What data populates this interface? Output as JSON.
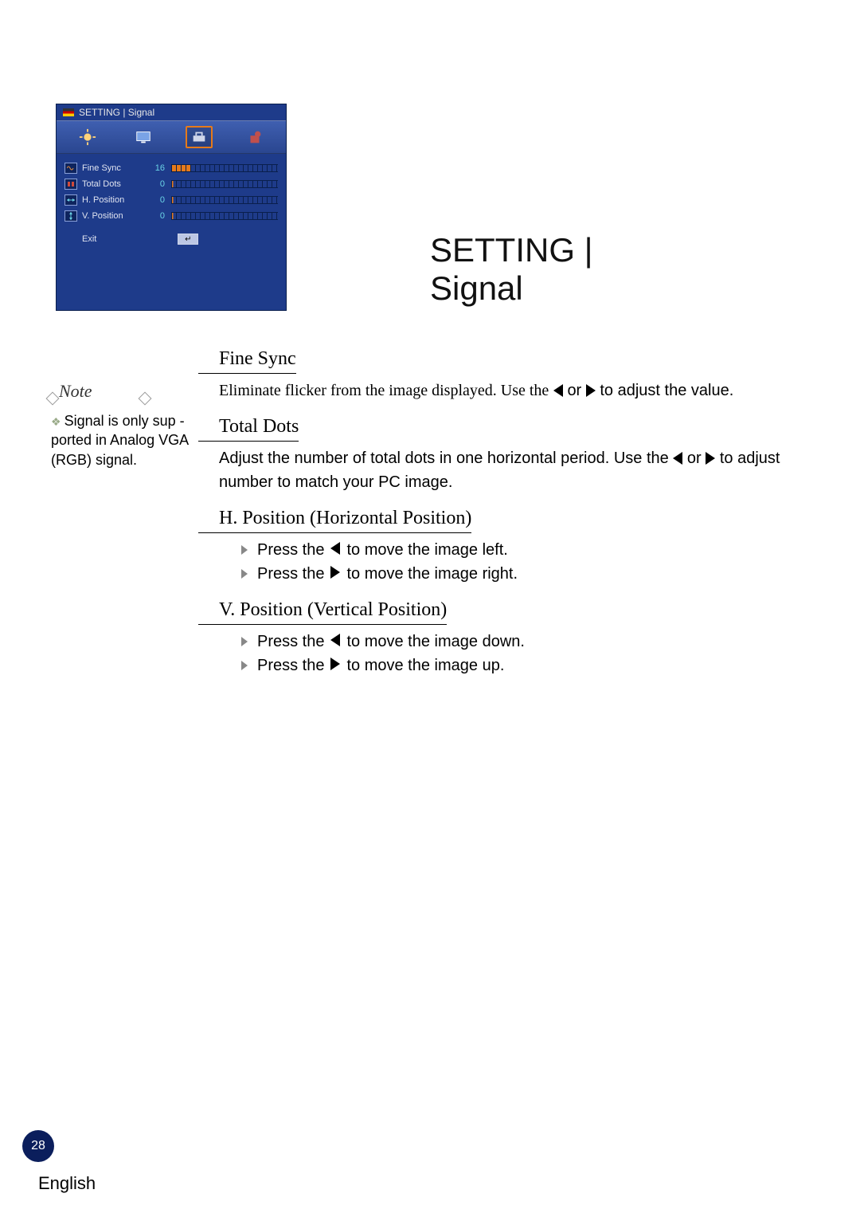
{
  "osd": {
    "breadcrumb": "SETTING | Signal",
    "rows": [
      {
        "label": "Fine Sync",
        "value": "16"
      },
      {
        "label": "Total Dots",
        "value": "0"
      },
      {
        "label": "H. Position",
        "value": "0"
      },
      {
        "label": "V. Position",
        "value": "0"
      }
    ],
    "exit": "Exit"
  },
  "heading_line1": "SETTING |",
  "heading_line2": "Signal",
  "sections": {
    "fine_sync": {
      "title": "Fine Sync",
      "body_a": "Eliminate flicker from the image displayed. Use the",
      "body_b": "or",
      "body_c": "to adjust the value."
    },
    "total_dots": {
      "title": "Total Dots",
      "body_a": "Adjust the number of total dots in one horizontal period. Use the",
      "body_b": "or",
      "body_c": "to adjust number to match your PC image."
    },
    "h_position": {
      "title": "H. Position (Horizontal Position)",
      "items": [
        {
          "pre": "Press the",
          "post": "to move the image left.",
          "dir": "left"
        },
        {
          "pre": "Press the",
          "post": "to move the image right.",
          "dir": "right"
        }
      ]
    },
    "v_position": {
      "title": "V. Position (Vertical Position)",
      "items": [
        {
          "pre": "Press the",
          "post": "to move the image down.",
          "dir": "left"
        },
        {
          "pre": "Press the",
          "post": "to move the image up.",
          "dir": "right"
        }
      ]
    }
  },
  "note": {
    "label": "Note",
    "text": "Signal is only sup - ported in Analog VGA (RGB) signal."
  },
  "footer": {
    "page": "28",
    "language": "English"
  }
}
